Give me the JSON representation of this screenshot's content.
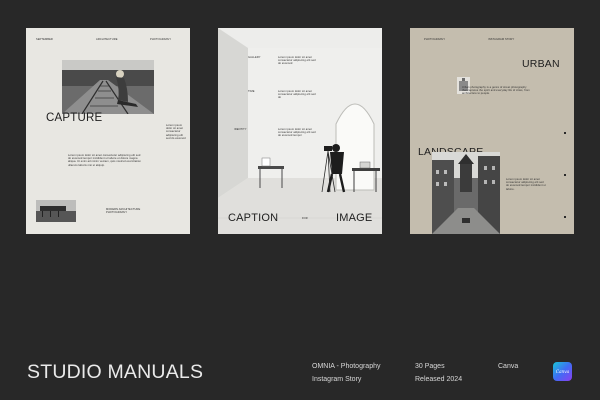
{
  "card1": {
    "header": [
      "SEPTEMBER",
      "ARCHITECTURE",
      "PHOTOGRAPHY"
    ],
    "headline": "CAPTURE",
    "side_note": "Lorem ipsum dolor sit amet consectetur adipiscing elit sed do eiusmod",
    "body": "Lorem ipsum dolor sit amet consectetur adipiscing elit sed do eiusmod tempor incididunt ut labore et dolore magna aliqua. Ut enim ad minim veniam, quis nostrud exercitation ullamco laboris nisi ut aliquip.",
    "footer_note": "MODERN ARCHITECTURE PHOTOGRAPHY"
  },
  "card2": {
    "labels": [
      "GALLERY",
      "TIME",
      "IDENTITY"
    ],
    "paragraphs": [
      "Lorem ipsum dolor sit amet consectetur adipiscing elit sed do eiusmod",
      "Lorem ipsum dolor sit amet consectetur adipiscing elit sed do",
      "Lorem ipsum dolor sit amet consectetur adipiscing elit sed do eiusmod tempor"
    ],
    "caption_left": "CAPTION",
    "caption_mid": "FOR",
    "caption_right": "IMAGE"
  },
  "card3": {
    "header": [
      "PHOTOGRAPHY",
      "INSTAGRAM STORY"
    ],
    "word_top": "URBAN",
    "word_mid": "LANDSCAPE",
    "body_top": "Urban photography is a genre of street photography that captures the spirit and everyday life of cities, from architecture to people.",
    "body_side": "Lorem ipsum dolor sit amet consectetur adipiscing elit sed do eiusmod tempor incididunt ut labore."
  },
  "footer": {
    "title": "STUDIO MANUALS",
    "product_line1": "OMNIA - Photography",
    "product_line2": "Instagram Story",
    "pages": "30 Pages",
    "released": "Released 2024",
    "platform": "Canva",
    "badge": "Canva"
  }
}
